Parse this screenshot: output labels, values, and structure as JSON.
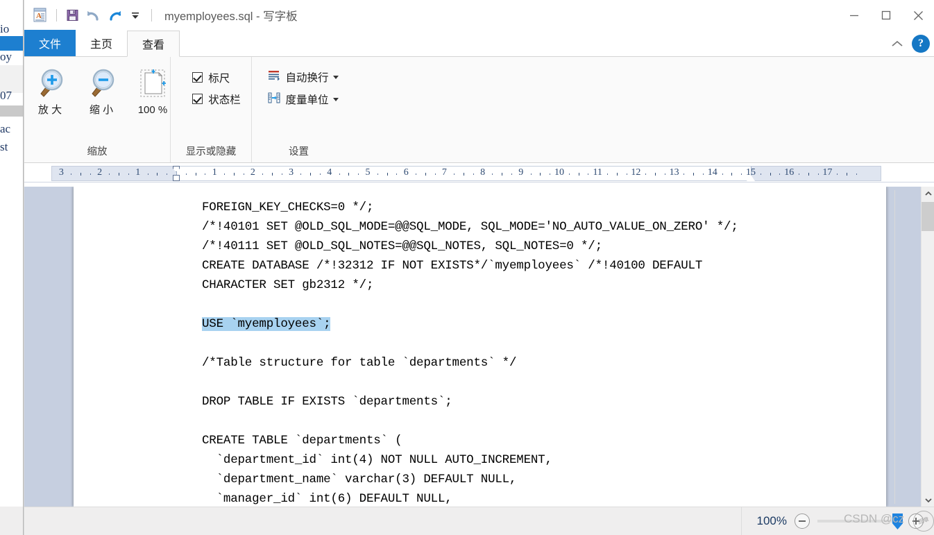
{
  "window": {
    "title": "myemployees.sql - 写字板",
    "app_icon": "wordpad-icon",
    "controls": {
      "minimize": "minimize-icon",
      "maximize": "maximize-icon",
      "close": "close-icon"
    }
  },
  "quick_access": {
    "save": "save-icon",
    "undo": "undo-icon",
    "redo": "redo-icon",
    "customize": "chevron-down-icon"
  },
  "tabs": [
    {
      "label": "文件",
      "type": "file",
      "active": false
    },
    {
      "label": "主页",
      "type": "normal",
      "active": false
    },
    {
      "label": "查看",
      "type": "normal",
      "active": true
    }
  ],
  "tabbar_right": {
    "collapse_ribbon": "chevron-up-icon",
    "help": "?"
  },
  "ribbon": {
    "groups": [
      {
        "name": "缩放",
        "buttons": [
          {
            "label": "放\n大",
            "icon": "zoom-in-icon"
          },
          {
            "label": "缩\n小",
            "icon": "zoom-out-icon"
          },
          {
            "label": "100\n%",
            "icon": "page-fit-icon"
          }
        ]
      },
      {
        "name": "显示或隐藏",
        "checks": [
          {
            "label": "标尺",
            "checked": true
          },
          {
            "label": "状态栏",
            "checked": true
          }
        ]
      },
      {
        "name": "设置",
        "commands": [
          {
            "label": "自动换行",
            "icon": "word-wrap-icon",
            "dropdown": true
          },
          {
            "label": "度量单位",
            "icon": "measure-unit-icon",
            "dropdown": true
          }
        ]
      }
    ]
  },
  "ruler": {
    "left_marks": [
      "3",
      "2",
      "1"
    ],
    "right_marks": [
      "1",
      "2",
      "3",
      "4",
      "5",
      "6",
      "7",
      "8",
      "9",
      "10",
      "11",
      "12",
      "13",
      "14",
      "15",
      "16",
      "17"
    ],
    "left_indent_pos": "0",
    "right_indent_pos": "14.5"
  },
  "document": {
    "lines": [
      "FOREIGN_KEY_CHECKS=0 */;",
      "/*!40101 SET @OLD_SQL_MODE=@@SQL_MODE, SQL_MODE='NO_AUTO_VALUE_ON_ZERO' */;",
      "/*!40111 SET @OLD_SQL_NOTES=@@SQL_NOTES, SQL_NOTES=0 */;",
      "CREATE DATABASE /*!32312 IF NOT EXISTS*/`myemployees` /*!40100 DEFAULT",
      "CHARACTER SET gb2312 */;",
      "",
      "USE `myemployees`;",
      "",
      "/*Table structure for table `departments` */",
      "",
      "DROP TABLE IF EXISTS `departments`;",
      "",
      "CREATE TABLE `departments` (",
      "  `department_id` int(4) NOT NULL AUTO_INCREMENT,",
      "  `department_name` varchar(3) DEFAULT NULL,",
      "  `manager_id` int(6) DEFAULT NULL,"
    ],
    "highlighted_line_index": 6,
    "highlight_color": "#a8d2f0"
  },
  "status_bar": {
    "zoom_percent": "100%",
    "zoom_out": "minus-icon",
    "zoom_in": "plus-icon"
  },
  "watermark": {
    "text": "CSDN @cz",
    "stamp": "圆章"
  },
  "background_window": {
    "fragments": [
      "io",
      "oy",
      "07",
      "ac",
      "st"
    ]
  }
}
